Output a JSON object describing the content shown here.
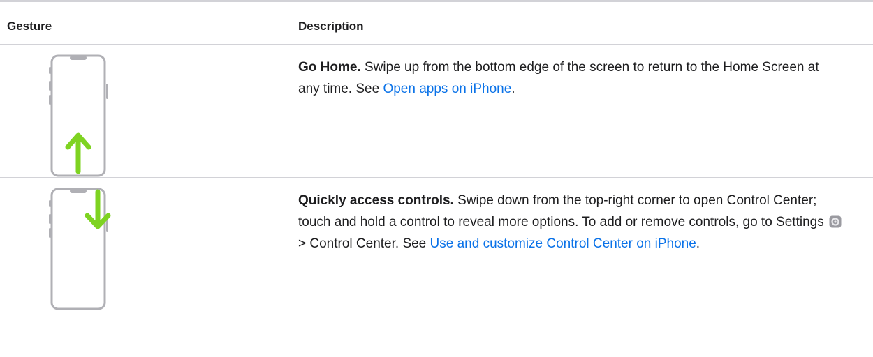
{
  "table": {
    "header": {
      "gesture": "Gesture",
      "description": "Description"
    },
    "rows": [
      {
        "icon": "swipe-up-icon",
        "lead": "Go Home.",
        "text_before_link": " Swipe up from the bottom edge of the screen to return to the Home Screen at any time. See ",
        "link": "Open apps on iPhone",
        "text_after_link": "."
      },
      {
        "icon": "swipe-down-top-right-icon",
        "lead": "Quickly access controls.",
        "text_before_icon": " Swipe down from the top-right corner to open Control Center; touch and hold a control to reveal more options. To add or remove controls, go to Settings ",
        "inline_icon": "settings-gear-icon",
        "text_after_icon": " > Control Center. See ",
        "link": "Use and customize Control Center on iPhone",
        "text_after_link": "."
      }
    ]
  },
  "colors": {
    "gesture_arrow": "#7ed321",
    "phone_outline": "#b0b0b5",
    "link": "#0a72e8",
    "rule": "#d2d2d7"
  }
}
